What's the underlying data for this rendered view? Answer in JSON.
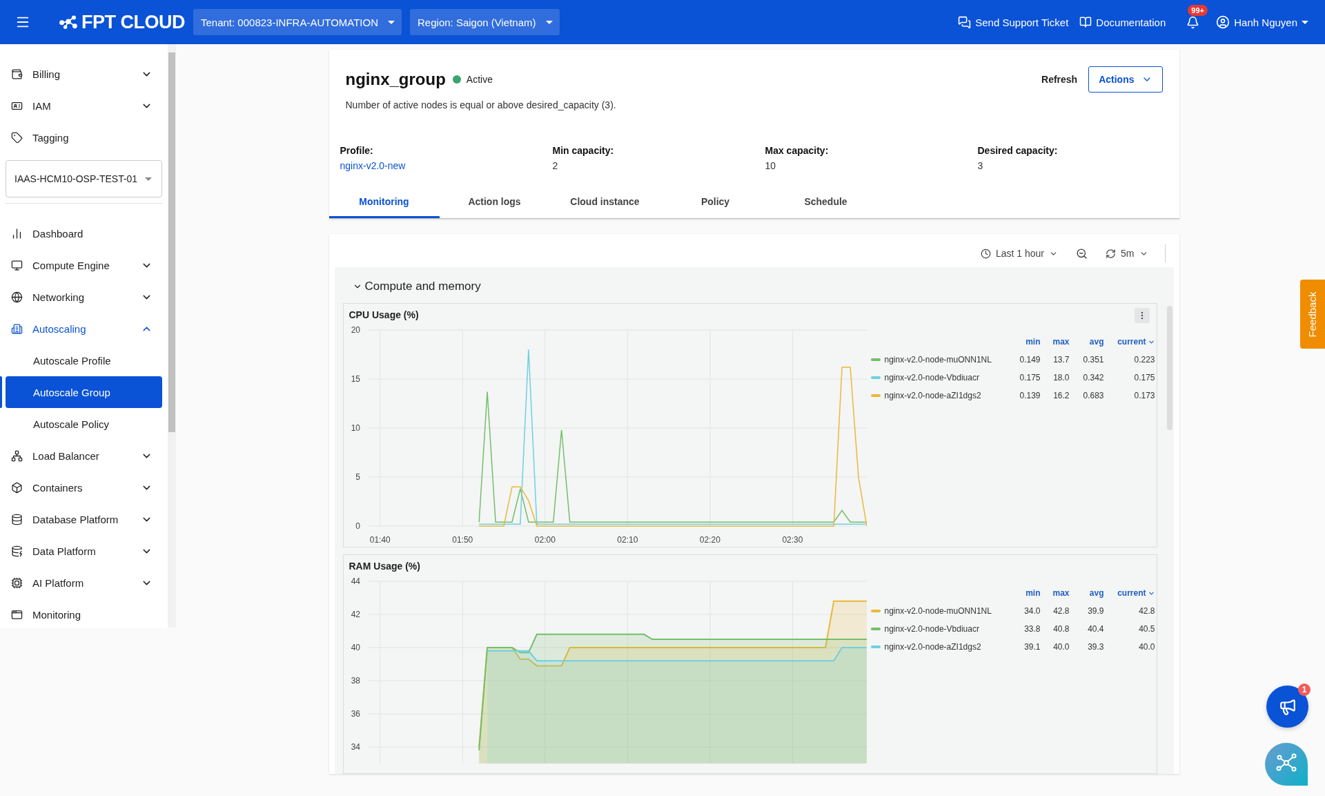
{
  "topbar": {
    "logo": "FPT CLOUD",
    "tenant": "Tenant: 000823-INFRA-AUTOMATION",
    "region": "Region: Saigon (Vietnam)",
    "links": [
      "Send Support Ticket",
      "Documentation"
    ],
    "notifications": "99+",
    "user": "Hanh Nguyen"
  },
  "sidebar": {
    "items": [
      {
        "kind": "group",
        "label": "Billing",
        "expanded": false
      },
      {
        "kind": "group",
        "label": "IAM",
        "expanded": false
      },
      {
        "kind": "link",
        "label": "Tagging"
      },
      {
        "kind": "select",
        "value": "IAAS-HCM10-OSP-TEST-01"
      },
      {
        "kind": "link",
        "label": "Dashboard"
      },
      {
        "kind": "group",
        "label": "Compute Engine",
        "expanded": false
      },
      {
        "kind": "group",
        "label": "Networking",
        "expanded": false
      },
      {
        "kind": "group",
        "label": "Autoscaling",
        "expanded": true,
        "children": [
          {
            "label": "Autoscale Profile",
            "selected": false
          },
          {
            "label": "Autoscale Group",
            "selected": true
          },
          {
            "label": "Autoscale Policy",
            "selected": false
          }
        ]
      },
      {
        "kind": "group",
        "label": "Load Balancer",
        "expanded": false
      },
      {
        "kind": "group",
        "label": "Containers",
        "expanded": false
      },
      {
        "kind": "group",
        "label": "Database Platform",
        "expanded": false
      },
      {
        "kind": "group",
        "label": "Data Platform",
        "expanded": false
      },
      {
        "kind": "group",
        "label": "AI Platform",
        "expanded": false
      },
      {
        "kind": "link",
        "label": "Monitoring"
      }
    ]
  },
  "group": {
    "name": "nginx_group",
    "status": "Active",
    "message": "Number of active nodes is equal or above desired_capacity (3).",
    "refresh": "Refresh",
    "actions": "Actions",
    "fields": [
      {
        "label": "Profile:",
        "value": "nginx-v2.0-new",
        "kind": "link"
      },
      {
        "label": "Min capacity:",
        "value": "2",
        "kind": "text"
      },
      {
        "label": "Max capacity:",
        "value": "10",
        "kind": "text"
      },
      {
        "label": "Desired capacity:",
        "value": "3",
        "kind": "text"
      }
    ]
  },
  "tabs": [
    {
      "label": "Monitoring",
      "selected": true
    },
    {
      "label": "Action logs",
      "selected": false
    },
    {
      "label": "Cloud instance",
      "selected": false
    },
    {
      "label": "Policy",
      "selected": false
    },
    {
      "label": "Schedule",
      "selected": false
    }
  ],
  "monitoring": {
    "time_range": "Last 1 hour",
    "refresh_interval": "5m",
    "section": {
      "title": "Compute and memory",
      "expanded": true
    },
    "panels": [
      {
        "title": "CPU Usage (%)",
        "legend_columns": [
          "min",
          "max",
          "avg",
          "current"
        ],
        "legend": [
          {
            "min": "0.149",
            "max": "13.7",
            "avg": "0.351",
            "current": "0.223"
          },
          {
            "min": "0.175",
            "max": "18.0",
            "avg": "0.342",
            "current": "0.175"
          },
          {
            "min": "0.139",
            "max": "16.2",
            "avg": "0.683",
            "current": "0.173"
          }
        ],
        "chart_data": {
          "type": "line",
          "x": [
            112,
            113,
            114,
            115,
            116,
            117,
            118,
            119,
            120,
            121,
            122,
            123,
            124,
            125,
            126,
            127,
            128,
            129,
            130,
            131,
            132,
            133,
            134,
            135,
            136,
            137,
            138,
            139,
            140,
            141,
            142,
            143,
            144,
            145,
            146,
            147,
            148,
            149,
            150,
            151,
            152,
            153,
            154,
            155,
            156,
            157,
            158,
            159
          ],
          "xlim": [
            98.6,
            159
          ],
          "ylim": [
            0,
            20
          ],
          "grid": true,
          "yticks": [
            {
              "value": 0,
              "label": "0"
            },
            {
              "value": 5,
              "label": "5"
            },
            {
              "value": 10,
              "label": "10"
            },
            {
              "value": 15,
              "label": "15"
            },
            {
              "value": 20,
              "label": "20"
            }
          ],
          "xticks": [
            {
              "value": 100,
              "label": "01:40"
            },
            {
              "value": 110,
              "label": "01:50"
            },
            {
              "value": 120,
              "label": "02:00"
            },
            {
              "value": 130,
              "label": "02:10"
            },
            {
              "value": 140,
              "label": "02:20"
            },
            {
              "value": 150,
              "label": "02:30"
            }
          ],
          "series": [
            {
              "name": "nginx-v2.0-node-muONN1NL",
              "color": "#73bf69",
              "values": [
                0.4,
                13.7,
                0.4,
                0.4,
                0.4,
                3.8,
                0.4,
                0.4,
                0.4,
                0.4,
                9.8,
                0.4,
                0.4,
                0.4,
                0.4,
                0.4,
                0.4,
                0.4,
                0.4,
                0.4,
                0.4,
                0.4,
                0.4,
                0.4,
                0.4,
                0.4,
                0.4,
                0.4,
                0.4,
                0.4,
                0.4,
                0.4,
                0.4,
                0.4,
                0.4,
                0.4,
                0.4,
                0.4,
                0.4,
                0.4,
                0.4,
                0.4,
                0.4,
                0.4,
                1.6,
                0.4,
                0.4,
                0.4
              ]
            },
            {
              "name": "nginx-v2.0-node-Vbdiuacr",
              "color": "#6ed0e0",
              "values": [
                0.2,
                0.2,
                0.2,
                0.2,
                0.2,
                0.2,
                18.0,
                0.2,
                0.2,
                0.2,
                0.2,
                0.2,
                0.2,
                0.2,
                0.2,
                0.2,
                0.2,
                0.2,
                0.2,
                0.2,
                0.2,
                0.2,
                0.2,
                0.2,
                0.2,
                0.2,
                0.2,
                0.2,
                0.2,
                0.2,
                0.2,
                0.2,
                0.2,
                0.2,
                0.2,
                0.2,
                0.2,
                0.2,
                0.2,
                0.2,
                0.2,
                0.2,
                0.2,
                0.2,
                0.2,
                0.2,
                0.2,
                0.2
              ]
            },
            {
              "name": "nginx-v2.0-node-aZI1dgs2",
              "color": "#eab839",
              "values": [
                0.0,
                0.0,
                0.0,
                0.0,
                4.0,
                4.0,
                2.6,
                0.0,
                0.0,
                0.0,
                0.0,
                0.0,
                0.0,
                0.0,
                0.0,
                0.0,
                0.0,
                0.0,
                0.0,
                0.0,
                0.0,
                0.0,
                0.0,
                0.0,
                0.0,
                0.0,
                0.0,
                0.0,
                0.0,
                0.0,
                0.0,
                0.0,
                0.0,
                0.0,
                0.0,
                0.0,
                0.0,
                0.0,
                0.0,
                0.0,
                0.0,
                0.0,
                0.0,
                0.0,
                16.2,
                16.2,
                5.0,
                0.0
              ]
            }
          ]
        }
      },
      {
        "title": "RAM Usage (%)",
        "legend_columns": [
          "min",
          "max",
          "avg",
          "current"
        ],
        "legend": [
          {
            "min": "34.0",
            "max": "42.8",
            "avg": "39.9",
            "current": "42.8"
          },
          {
            "min": "33.8",
            "max": "40.8",
            "avg": "40.4",
            "current": "40.5"
          },
          {
            "min": "39.1",
            "max": "40.0",
            "avg": "39.3",
            "current": "40.0"
          }
        ],
        "chart_data": {
          "type": "area",
          "x": [
            112,
            113,
            114,
            115,
            116,
            117,
            118,
            119,
            120,
            121,
            122,
            123,
            124,
            125,
            126,
            127,
            128,
            129,
            130,
            131,
            132,
            133,
            134,
            135,
            136,
            137,
            138,
            139,
            140,
            141,
            142,
            143,
            144,
            145,
            146,
            147,
            148,
            149,
            150,
            151,
            152,
            153,
            154,
            155,
            156,
            157,
            158,
            159
          ],
          "xlim": [
            98.6,
            159
          ],
          "ylim": [
            33,
            44
          ],
          "grid": true,
          "yticks": [
            {
              "value": 34,
              "label": "34"
            },
            {
              "value": 36,
              "label": "36"
            },
            {
              "value": 38,
              "label": "38"
            },
            {
              "value": 40,
              "label": "40"
            },
            {
              "value": 42,
              "label": "42"
            },
            {
              "value": 44,
              "label": "44"
            }
          ],
          "series": [
            {
              "name": "nginx-v2.0-node-muONN1NL",
              "color": "#eab839",
              "values": [
                34.0,
                40.0,
                40.0,
                40.0,
                40.0,
                39.3,
                39.3,
                38.9,
                38.9,
                38.9,
                38.9,
                40.0,
                40.0,
                40.0,
                40.0,
                40.0,
                40.0,
                40.0,
                40.0,
                40.0,
                40.0,
                40.0,
                40.0,
                40.0,
                40.0,
                40.0,
                40.0,
                40.0,
                40.0,
                40.0,
                40.0,
                40.0,
                40.0,
                40.0,
                40.0,
                40.0,
                40.0,
                40.0,
                40.0,
                40.0,
                40.0,
                40.0,
                40.0,
                42.8,
                42.8,
                42.8,
                42.8,
                42.8
              ]
            },
            {
              "name": "nginx-v2.0-node-Vbdiuacr",
              "color": "#73bf69",
              "values": [
                33.8,
                40.0,
                40.0,
                40.0,
                40.0,
                39.7,
                39.7,
                40.8,
                40.8,
                40.8,
                40.8,
                40.8,
                40.8,
                40.8,
                40.8,
                40.8,
                40.8,
                40.8,
                40.8,
                40.8,
                40.8,
                40.5,
                40.5,
                40.5,
                40.5,
                40.5,
                40.5,
                40.5,
                40.5,
                40.5,
                40.5,
                40.5,
                40.5,
                40.5,
                40.5,
                40.5,
                40.5,
                40.5,
                40.5,
                40.5,
                40.5,
                40.5,
                40.5,
                40.5,
                40.5,
                40.5,
                40.5,
                40.5
              ]
            },
            {
              "name": "nginx-v2.0-node-aZI1dgs2",
              "color": "#6ed0e0",
              "values": [
                null,
                39.8,
                39.8,
                39.8,
                39.8,
                39.8,
                39.8,
                39.2,
                39.2,
                39.2,
                39.2,
                39.2,
                39.2,
                39.2,
                39.2,
                39.2,
                39.2,
                39.2,
                39.2,
                39.2,
                39.2,
                39.2,
                39.2,
                39.2,
                39.2,
                39.2,
                39.2,
                39.2,
                39.2,
                39.2,
                39.2,
                39.2,
                39.2,
                39.2,
                39.2,
                39.2,
                39.2,
                39.2,
                39.2,
                39.2,
                39.2,
                39.2,
                39.2,
                39.2,
                40.0,
                40.0,
                40.0,
                40.0
              ]
            }
          ]
        }
      }
    ]
  },
  "feedback": "Feedback",
  "announcement_badge": "1"
}
